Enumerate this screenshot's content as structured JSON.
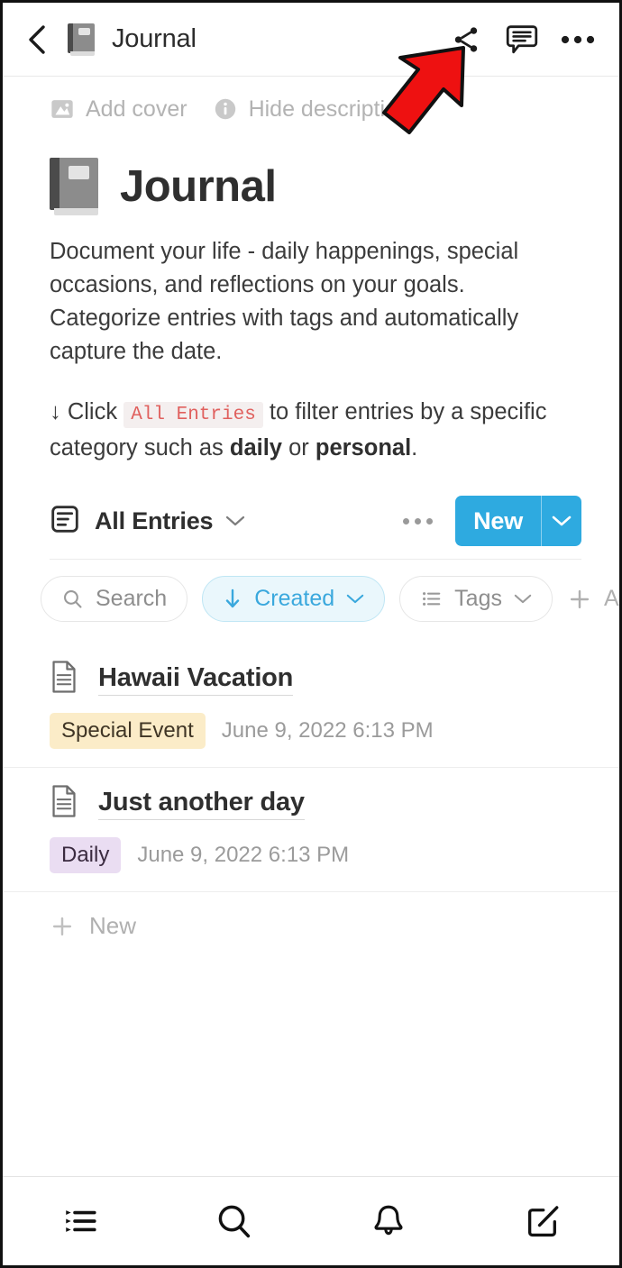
{
  "appbar": {
    "title": "Journal",
    "back_icon": "chevron-left-icon",
    "emoji": "notebook-emoji",
    "actions": [
      {
        "name": "share-icon",
        "label": "Share"
      },
      {
        "name": "comment-icon",
        "label": "Comments"
      },
      {
        "name": "more-icon",
        "label": "More"
      }
    ]
  },
  "annotation": {
    "arrow_color": "#ee1111",
    "points_to": "share-icon"
  },
  "meta": {
    "add_cover": "Add cover",
    "hide_description": "Hide description"
  },
  "page": {
    "title": "Journal",
    "description": "Document your life - daily happenings, special occasions, and reflections on your goals. Categorize entries with tags and automatically capture the date.",
    "hint": {
      "arrow": "↓",
      "before": "Click",
      "code": "All Entries",
      "middle": "to filter entries by a specific category such as",
      "bold1": "daily",
      "conjunction": "or",
      "bold2": "personal",
      "end": "."
    }
  },
  "view": {
    "icon": "list-view-icon",
    "name": "All Entries",
    "caret": "chevron-down-icon",
    "options_icon": "more-horizontal-icon",
    "new_label": "New",
    "new_caret": "chevron-down-icon",
    "new_color": "#2eaae0"
  },
  "filters": [
    {
      "name": "search-chip",
      "label": "Search",
      "icon": "search-icon",
      "active": false,
      "caret": false
    },
    {
      "name": "created-chip",
      "label": "Created",
      "icon": "arrow-down-icon",
      "active": true,
      "caret": true
    },
    {
      "name": "tags-chip",
      "label": "Tags",
      "icon": "list-icon",
      "active": false,
      "caret": true
    },
    {
      "name": "add-filter",
      "label": "Add f",
      "icon": "plus-icon",
      "active": false,
      "caret": false
    }
  ],
  "entries": [
    {
      "icon": "page-icon",
      "title": "Hawaii Vacation",
      "tag": "Special Event",
      "tag_bg": "#fbecc8",
      "tag_color": "#3f3525",
      "date": "June 9, 2022 6:13 PM"
    },
    {
      "icon": "page-icon",
      "title": "Just another day",
      "tag": "Daily",
      "tag_bg": "#eaddf2",
      "tag_color": "#3b2b40",
      "date": "June 9, 2022 6:13 PM"
    }
  ],
  "list_footer": {
    "icon": "plus-icon",
    "label": "New"
  },
  "tabbar": [
    {
      "name": "tab-list",
      "icon": "list-bullets-icon",
      "label": "List"
    },
    {
      "name": "tab-search",
      "icon": "search-icon",
      "label": "Search"
    },
    {
      "name": "tab-notifications",
      "icon": "bell-icon",
      "label": "Notifications"
    },
    {
      "name": "tab-new-note",
      "icon": "compose-icon",
      "label": "New note"
    }
  ]
}
